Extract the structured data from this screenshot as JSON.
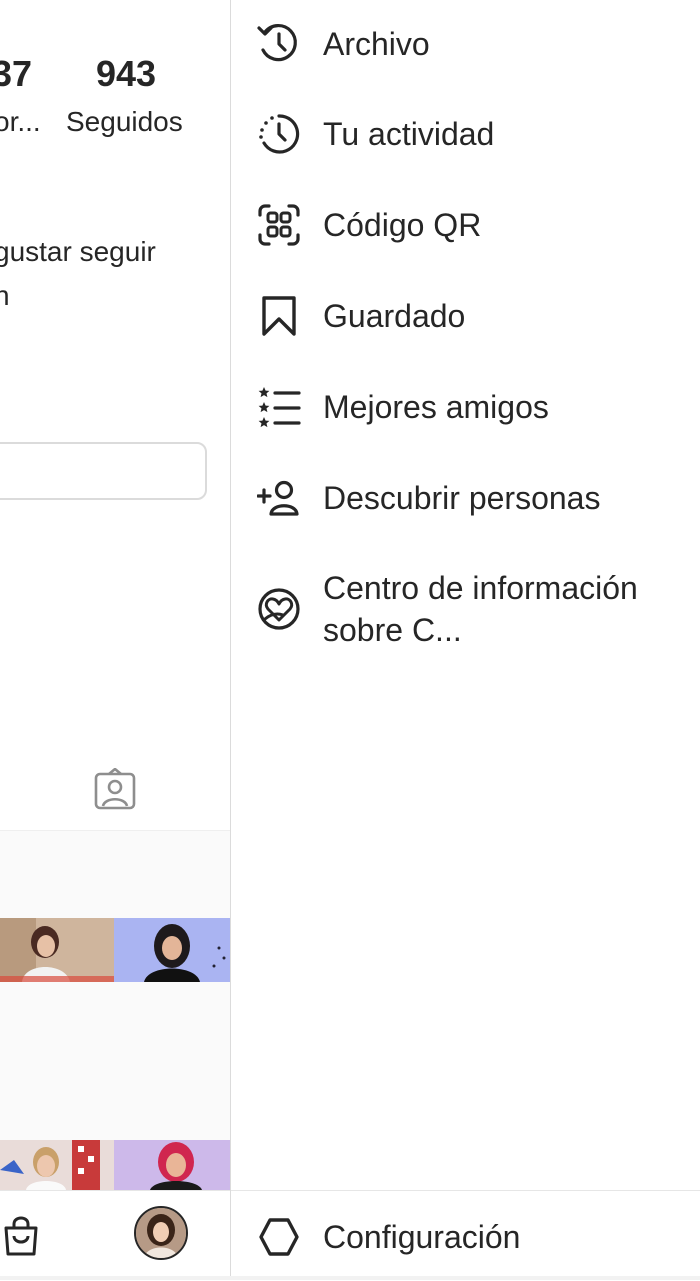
{
  "profile": {
    "stats": [
      {
        "number": "37",
        "label": "or..."
      },
      {
        "number": "943",
        "label": "Seguidos"
      }
    ],
    "bio_lines": [
      "gustar seguir",
      "n"
    ]
  },
  "menu": {
    "items": [
      {
        "label": "Archivo",
        "icon": "archive-icon"
      },
      {
        "label": "Tu actividad",
        "icon": "activity-icon"
      },
      {
        "label": "Código QR",
        "icon": "qr-code-icon"
      },
      {
        "label": "Guardado",
        "icon": "bookmark-icon"
      },
      {
        "label": "Mejores amigos",
        "icon": "close-friends-icon"
      },
      {
        "label": "Descubrir personas",
        "icon": "add-person-icon"
      },
      {
        "label": "Centro de información sobre C...",
        "icon": "covid-info-icon"
      }
    ],
    "footer": {
      "label": "Configuración",
      "icon": "settings-icon"
    }
  },
  "colors": {
    "text": "#262626",
    "border": "#dbdbdb",
    "background": "#ffffff",
    "grid_background": "#fafafa"
  }
}
